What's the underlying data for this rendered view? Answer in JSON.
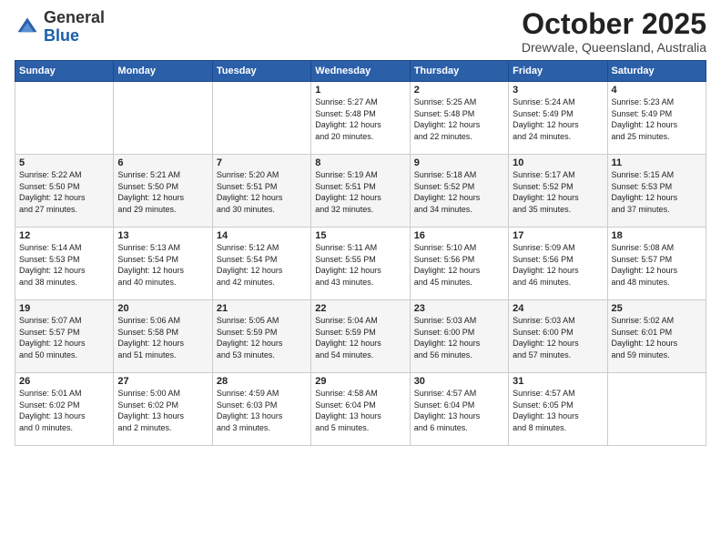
{
  "header": {
    "logo_general": "General",
    "logo_blue": "Blue",
    "month": "October 2025",
    "location": "Drewvale, Queensland, Australia"
  },
  "weekdays": [
    "Sunday",
    "Monday",
    "Tuesday",
    "Wednesday",
    "Thursday",
    "Friday",
    "Saturday"
  ],
  "weeks": [
    [
      {
        "day": "",
        "info": ""
      },
      {
        "day": "",
        "info": ""
      },
      {
        "day": "",
        "info": ""
      },
      {
        "day": "1",
        "info": "Sunrise: 5:27 AM\nSunset: 5:48 PM\nDaylight: 12 hours\nand 20 minutes."
      },
      {
        "day": "2",
        "info": "Sunrise: 5:25 AM\nSunset: 5:48 PM\nDaylight: 12 hours\nand 22 minutes."
      },
      {
        "day": "3",
        "info": "Sunrise: 5:24 AM\nSunset: 5:49 PM\nDaylight: 12 hours\nand 24 minutes."
      },
      {
        "day": "4",
        "info": "Sunrise: 5:23 AM\nSunset: 5:49 PM\nDaylight: 12 hours\nand 25 minutes."
      }
    ],
    [
      {
        "day": "5",
        "info": "Sunrise: 5:22 AM\nSunset: 5:50 PM\nDaylight: 12 hours\nand 27 minutes."
      },
      {
        "day": "6",
        "info": "Sunrise: 5:21 AM\nSunset: 5:50 PM\nDaylight: 12 hours\nand 29 minutes."
      },
      {
        "day": "7",
        "info": "Sunrise: 5:20 AM\nSunset: 5:51 PM\nDaylight: 12 hours\nand 30 minutes."
      },
      {
        "day": "8",
        "info": "Sunrise: 5:19 AM\nSunset: 5:51 PM\nDaylight: 12 hours\nand 32 minutes."
      },
      {
        "day": "9",
        "info": "Sunrise: 5:18 AM\nSunset: 5:52 PM\nDaylight: 12 hours\nand 34 minutes."
      },
      {
        "day": "10",
        "info": "Sunrise: 5:17 AM\nSunset: 5:52 PM\nDaylight: 12 hours\nand 35 minutes."
      },
      {
        "day": "11",
        "info": "Sunrise: 5:15 AM\nSunset: 5:53 PM\nDaylight: 12 hours\nand 37 minutes."
      }
    ],
    [
      {
        "day": "12",
        "info": "Sunrise: 5:14 AM\nSunset: 5:53 PM\nDaylight: 12 hours\nand 38 minutes."
      },
      {
        "day": "13",
        "info": "Sunrise: 5:13 AM\nSunset: 5:54 PM\nDaylight: 12 hours\nand 40 minutes."
      },
      {
        "day": "14",
        "info": "Sunrise: 5:12 AM\nSunset: 5:54 PM\nDaylight: 12 hours\nand 42 minutes."
      },
      {
        "day": "15",
        "info": "Sunrise: 5:11 AM\nSunset: 5:55 PM\nDaylight: 12 hours\nand 43 minutes."
      },
      {
        "day": "16",
        "info": "Sunrise: 5:10 AM\nSunset: 5:56 PM\nDaylight: 12 hours\nand 45 minutes."
      },
      {
        "day": "17",
        "info": "Sunrise: 5:09 AM\nSunset: 5:56 PM\nDaylight: 12 hours\nand 46 minutes."
      },
      {
        "day": "18",
        "info": "Sunrise: 5:08 AM\nSunset: 5:57 PM\nDaylight: 12 hours\nand 48 minutes."
      }
    ],
    [
      {
        "day": "19",
        "info": "Sunrise: 5:07 AM\nSunset: 5:57 PM\nDaylight: 12 hours\nand 50 minutes."
      },
      {
        "day": "20",
        "info": "Sunrise: 5:06 AM\nSunset: 5:58 PM\nDaylight: 12 hours\nand 51 minutes."
      },
      {
        "day": "21",
        "info": "Sunrise: 5:05 AM\nSunset: 5:59 PM\nDaylight: 12 hours\nand 53 minutes."
      },
      {
        "day": "22",
        "info": "Sunrise: 5:04 AM\nSunset: 5:59 PM\nDaylight: 12 hours\nand 54 minutes."
      },
      {
        "day": "23",
        "info": "Sunrise: 5:03 AM\nSunset: 6:00 PM\nDaylight: 12 hours\nand 56 minutes."
      },
      {
        "day": "24",
        "info": "Sunrise: 5:03 AM\nSunset: 6:00 PM\nDaylight: 12 hours\nand 57 minutes."
      },
      {
        "day": "25",
        "info": "Sunrise: 5:02 AM\nSunset: 6:01 PM\nDaylight: 12 hours\nand 59 minutes."
      }
    ],
    [
      {
        "day": "26",
        "info": "Sunrise: 5:01 AM\nSunset: 6:02 PM\nDaylight: 13 hours\nand 0 minutes."
      },
      {
        "day": "27",
        "info": "Sunrise: 5:00 AM\nSunset: 6:02 PM\nDaylight: 13 hours\nand 2 minutes."
      },
      {
        "day": "28",
        "info": "Sunrise: 4:59 AM\nSunset: 6:03 PM\nDaylight: 13 hours\nand 3 minutes."
      },
      {
        "day": "29",
        "info": "Sunrise: 4:58 AM\nSunset: 6:04 PM\nDaylight: 13 hours\nand 5 minutes."
      },
      {
        "day": "30",
        "info": "Sunrise: 4:57 AM\nSunset: 6:04 PM\nDaylight: 13 hours\nand 6 minutes."
      },
      {
        "day": "31",
        "info": "Sunrise: 4:57 AM\nSunset: 6:05 PM\nDaylight: 13 hours\nand 8 minutes."
      },
      {
        "day": "",
        "info": ""
      }
    ]
  ]
}
